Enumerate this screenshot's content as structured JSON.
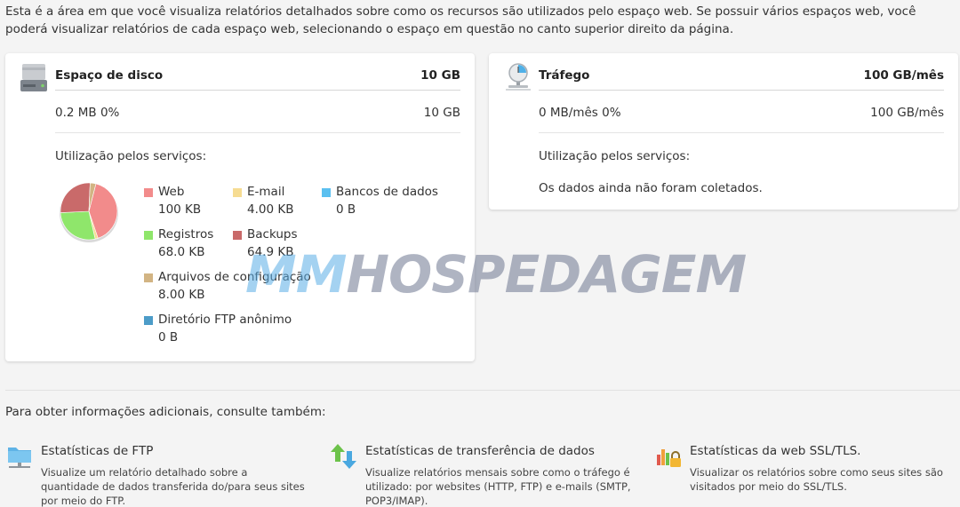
{
  "intro": "Esta é a área em que você visualiza relatórios detalhados sobre como os recursos são utilizados pelo espaço web. Se possuir vários espaços web, você poderá visualizar relatórios de cada espaço web, selecionando o espaço em questão no canto superior direito da página.",
  "disk": {
    "title": "Espaço de disco",
    "limit": "10 GB",
    "used": "0.2 MB 0%",
    "total": "10 GB",
    "usage_title": "Utilização pelos serviços:",
    "legend": [
      {
        "label": "Web",
        "value": "100 KB",
        "color": "#f28b8b"
      },
      {
        "label": "E-mail",
        "value": "4.00 KB",
        "color": "#f6dc92"
      },
      {
        "label": "Bancos de dados",
        "value": "0 B",
        "color": "#5bc0f0"
      },
      {
        "label": "Registros",
        "value": "68.0 KB",
        "color": "#8fe66b"
      },
      {
        "label": "Backups",
        "value": "64.9 KB",
        "color": "#c96a6a"
      },
      {
        "label": "Arquivos de configuração",
        "value": "8.00 KB",
        "color": "#d2b483"
      },
      {
        "label": "Diretório FTP anônimo",
        "value": "0 B",
        "color": "#4c9cc8"
      }
    ]
  },
  "traffic": {
    "title": "Tráfego",
    "limit": "100 GB/mês",
    "used": "0 MB/mês 0%",
    "total": "100 GB/mês",
    "usage_title": "Utilização pelos serviços:",
    "no_data": "Os dados ainda não foram coletados."
  },
  "more": {
    "title": "Para obter informações adicionais, consulte também:",
    "links": [
      {
        "title": "Estatísticas de FTP",
        "desc": "Visualize um relatório detalhado sobre a quantidade de dados transferida do/para seus sites por meio do FTP.",
        "icon": "ftp-stats-icon"
      },
      {
        "title": "Estatísticas de transferência de dados",
        "desc": "Visualize relatórios mensais sobre como o tráfego é utilizado: por websites (HTTP, FTP) e e-mails (SMTP, POP3/IMAP).",
        "icon": "transfer-stats-icon"
      },
      {
        "title": "Estatísticas da web SSL/TLS.",
        "desc": "Visualizar os relatórios sobre como seus sites são visitados por meio do SSL/TLS.",
        "icon": "ssl-stats-icon"
      }
    ]
  },
  "watermark": {
    "part1": "MM",
    "part2": "HOSPEDAGEM"
  }
}
